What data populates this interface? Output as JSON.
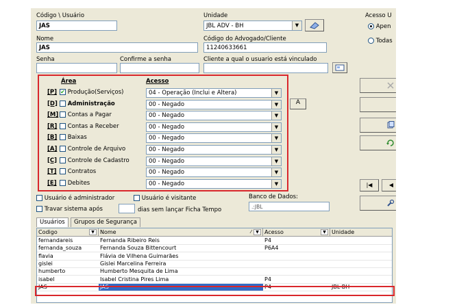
{
  "form": {
    "codigo_label": "Código \\ Usuário",
    "codigo_value": "JAS",
    "unidade_label": "Unidade",
    "unidade_value": "JBL ADV - BH",
    "nome_label": "Nome",
    "nome_value": "JAS",
    "codigo_adv_label": "Código do Advogado/Cliente",
    "codigo_adv_value": "11240633661",
    "senha_label": "Senha",
    "confirme_label": "Confirme a senha",
    "cliente_label": "Cliente a qual o usuario está vinculado",
    "acesso_label": "Acesso U",
    "acesso_opt1": "Apen",
    "acesso_opt2": "Todas",
    "btn_a": "A"
  },
  "perm": {
    "area_header": "Área",
    "acesso_header": "Acesso",
    "rows": [
      {
        "code": "[P]",
        "label": "Produção(Serviços)",
        "checked": true,
        "bold": false,
        "access": "04 - Operação (Inclui e Altera)"
      },
      {
        "code": "[D]",
        "label": "Administração",
        "checked": false,
        "bold": true,
        "access": "00 - Negado"
      },
      {
        "code": "[M]",
        "label": "Contas a Pagar",
        "checked": false,
        "bold": false,
        "access": "00 - Negado"
      },
      {
        "code": "[R]",
        "label": "Contas a Receber",
        "checked": false,
        "bold": false,
        "access": "00 - Negado"
      },
      {
        "code": "[B]",
        "label": "Baixas",
        "checked": false,
        "bold": false,
        "access": "00 - Negado"
      },
      {
        "code": "[A]",
        "label": "Controle de Arquivo",
        "checked": false,
        "bold": false,
        "access": "00 - Negado"
      },
      {
        "code": "[C]",
        "label": "Controle de Cadastro",
        "checked": false,
        "bold": false,
        "access": "00 - Negado"
      },
      {
        "code": "[T]",
        "label": "Contratos",
        "checked": false,
        "bold": false,
        "access": "00 - Negado"
      },
      {
        "code": "[E]",
        "label": "Debites",
        "checked": false,
        "bold": false,
        "access": "00 - Negado"
      }
    ]
  },
  "options": {
    "admin_label": "Usuário é administrador",
    "visitante_label": "Usuário é visitante",
    "travar_label": "Travar sistema após",
    "dias_label": "dias sem lançar Ficha Tempo",
    "banco_label": "Banco de Dados:",
    "banco_value": ".:JBL"
  },
  "tabs": [
    "Usuários",
    "Grupos de Segurança"
  ],
  "grid": {
    "headers": [
      "Codigo",
      "Nome",
      "Acesso",
      "Unidade"
    ],
    "rows": [
      [
        "fernandareis",
        "Fernanda Ribeiro Reis",
        "P4",
        ""
      ],
      [
        "fernanda_souza",
        "Fernanda Souza Bittencourt",
        "P6A4",
        ""
      ],
      [
        "flavia",
        "Flávia de Vilhena Guimarães",
        "",
        ""
      ],
      [
        "gislei",
        "Gislei Marcelina Ferreira",
        "",
        ""
      ],
      [
        "humberto",
        "Humberto Mesquita de Lima",
        "",
        ""
      ],
      [
        "isabel",
        "Isabel Cristina Pires Lima",
        "P4",
        ""
      ],
      [
        "JAS",
        "JAS",
        "P4",
        "JBL-BH"
      ]
    ]
  },
  "colors": {
    "highlight": "#d9262b",
    "selection": "#316ac5"
  }
}
